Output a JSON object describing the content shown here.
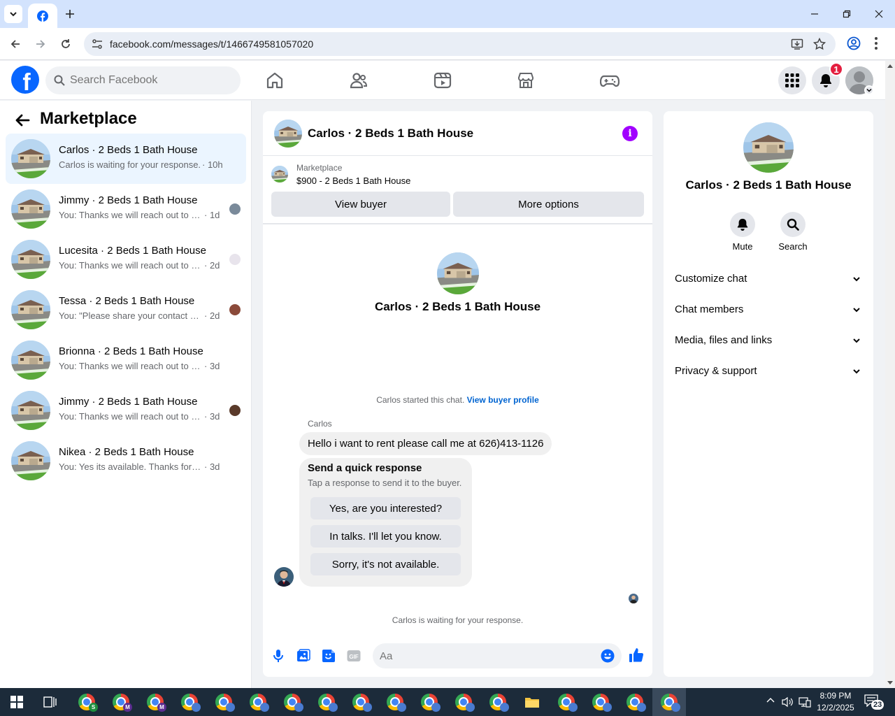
{
  "browser": {
    "url": "facebook.com/messages/t/1466749581057020",
    "tab_icon": "facebook-icon"
  },
  "fb": {
    "search_placeholder": "Search Facebook",
    "notification_count": "1"
  },
  "sidebar": {
    "title": "Marketplace",
    "conversations": [
      {
        "title": "Carlos · 2 Beds 1 Bath House",
        "snippet": "Carlos is waiting for your response.",
        "time": "· 10h",
        "active": true
      },
      {
        "title": "Jimmy · 2 Beds 1 Bath House",
        "snippet": "You: Thanks we will reach out to yo...",
        "time": "· 1d"
      },
      {
        "title": "Lucesita · 2 Beds 1 Bath House",
        "snippet": "You: Thanks we will reach out to yo...",
        "time": "· 2d"
      },
      {
        "title": "Tessa · 2 Beds 1 Bath House",
        "snippet": "You: \"Please share your contact nu...",
        "time": "· 2d"
      },
      {
        "title": "Brionna · 2 Beds 1 Bath House",
        "snippet": "You: Thanks we will reach out to you s...",
        "time": "· 3d"
      },
      {
        "title": "Jimmy · 2 Beds 1 Bath House",
        "snippet": "You: Thanks we will reach out to yo...",
        "time": "· 3d"
      },
      {
        "title": "Nikea · 2 Beds 1 Bath House",
        "snippet": "You: Yes its available. Thanks for mess...",
        "time": "· 3d"
      }
    ]
  },
  "chat": {
    "title": "Carlos · 2 Beds 1 Bath House",
    "listing_source": "Marketplace",
    "listing_title": "$900 - 2 Beds 1 Bath House",
    "view_buyer": "View buyer",
    "more_options": "More options",
    "intro_name": "Carlos · 2 Beds 1 Bath House",
    "started_text": "Carlos started this chat.",
    "view_buyer_profile": "View buyer profile",
    "sender": "Carlos",
    "message": "Hello i want to rent please call me at 626)413-1126",
    "quick_title": "Send a quick response",
    "quick_sub": "Tap a response to send it to the buyer.",
    "quick_replies": [
      "Yes, are you interested?",
      "In talks. I'll let you know.",
      "Sorry, it's not available."
    ],
    "waiting": "Carlos is waiting for your response.",
    "input_placeholder": "Aa"
  },
  "info": {
    "name": "Carlos · 2 Beds 1 Bath House",
    "mute": "Mute",
    "search": "Search",
    "sections": [
      "Customize chat",
      "Chat members",
      "Media, files and links",
      "Privacy & support"
    ]
  },
  "taskbar": {
    "time": "8:09 PM",
    "date": "12/2/2025",
    "notifications": "23"
  }
}
